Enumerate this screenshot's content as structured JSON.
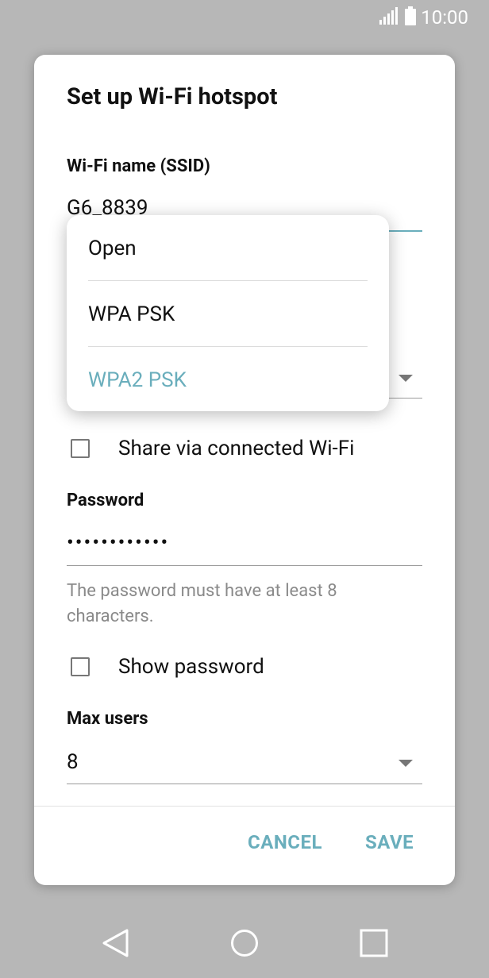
{
  "status_bar": {
    "time": "10:00"
  },
  "dialog": {
    "title": "Set up Wi-Fi hotspot",
    "ssid_label": "Wi-Fi name (SSID)",
    "ssid_value": "G6_8839",
    "share_label": "Share via connected Wi-Fi",
    "password_label": "Password",
    "password_dots": "••••••••••••",
    "password_hint": "The password must have at least 8 characters.",
    "show_password_label": "Show password",
    "max_users_label": "Max users",
    "max_users_value": "8",
    "cancel_label": "CANCEL",
    "save_label": "SAVE"
  },
  "security_menu": {
    "options": [
      "Open",
      "WPA PSK",
      "WPA2 PSK"
    ],
    "selected": "WPA2 PSK"
  },
  "colors": {
    "accent": "#6aaebc",
    "scrim": "#b7b7b7"
  }
}
